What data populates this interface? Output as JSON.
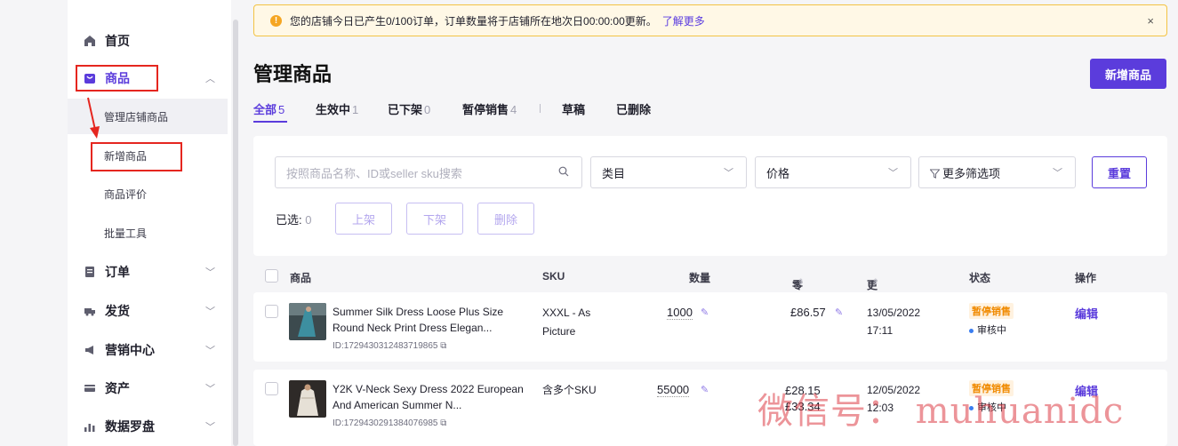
{
  "sidebar": {
    "home": "首页",
    "products": "商品",
    "sub_items": [
      "管理店铺商品",
      "新增商品",
      "商品评价",
      "批量工具"
    ],
    "orders": "订单",
    "shipping": "发货",
    "marketing": "营销中心",
    "assets": "资产",
    "data_compass": "数据罗盘"
  },
  "banner": {
    "message": "您的店铺今日已产生0/100订单，订单数量将于店铺所在地次日00:00:00更新。",
    "link": "了解更多",
    "close": "×"
  },
  "page": {
    "title": "管理商品",
    "add_button": "新增商品"
  },
  "tabs": [
    {
      "label": "全部",
      "count": "5"
    },
    {
      "label": "生效中",
      "count": "1"
    },
    {
      "label": "已下架",
      "count": "0"
    },
    {
      "label": "暂停销售",
      "count": "4"
    },
    {
      "label": "草稿",
      "count": ""
    },
    {
      "label": "已删除",
      "count": ""
    }
  ],
  "filters": {
    "search_placeholder": "按照商品名称、ID或seller sku搜索",
    "category": "类目",
    "price": "价格",
    "more_filters": "更多筛选项",
    "reset": "重置",
    "selected_label": "已选:",
    "selected_count": "0",
    "batch_buttons": [
      "上架",
      "下架",
      "删除"
    ]
  },
  "table": {
    "headers": {
      "product": "商品",
      "sku": "SKU",
      "quantity": "数量",
      "price": "零售价",
      "updated": "更新时间",
      "status": "状态",
      "action": "操作"
    },
    "rows": [
      {
        "name": "Summer Silk Dress Loose Plus Size Round Neck Print Dress Elegan...",
        "id": "ID:1729430312483719865",
        "sku": "XXXL - As Picture",
        "quantity": "1000",
        "price": "£86.57",
        "updated_date": "13/05/2022",
        "updated_time": "17:11",
        "status": "暂停销售",
        "review": "审核中",
        "action": "编辑"
      },
      {
        "name": "Y2K V-Neck Sexy Dress 2022 European And American Summer N...",
        "id": "ID:1729430291384076985",
        "sku": "含多个SKU",
        "quantity": "55000",
        "price": "£28.15",
        "price2": "£33.34",
        "updated_date": "12/05/2022",
        "updated_time": "12:03",
        "status": "暂停销售",
        "review": "审核中",
        "action": "编辑"
      }
    ]
  },
  "watermark": "微信号： muhuanidc",
  "icons": {
    "home": "home-icon",
    "products": "bag-icon",
    "orders": "document-icon",
    "shipping": "truck-icon",
    "marketing": "megaphone-icon",
    "assets": "card-icon",
    "data": "bar-chart-icon"
  },
  "colors": {
    "accent": "#5b3cdc",
    "warning": "#f08a00",
    "annotation": "#e5261f"
  }
}
